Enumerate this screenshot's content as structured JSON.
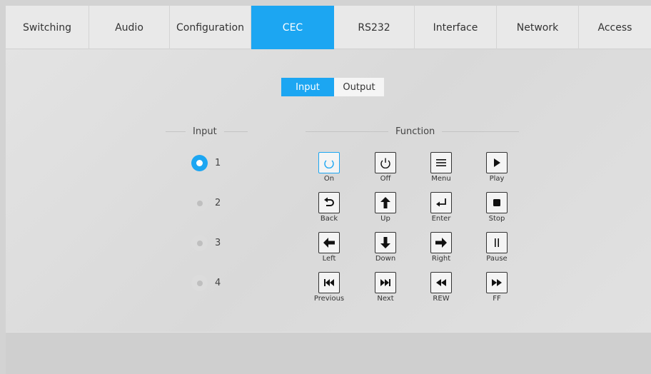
{
  "tabs": [
    {
      "label": "Switching",
      "active": false
    },
    {
      "label": "Audio",
      "active": false
    },
    {
      "label": "Configuration",
      "active": false
    },
    {
      "label": "CEC",
      "active": true
    },
    {
      "label": "RS232",
      "active": false
    },
    {
      "label": "Interface",
      "active": false
    },
    {
      "label": "Network",
      "active": false
    },
    {
      "label": "Access",
      "active": false
    }
  ],
  "subtabs": {
    "input": "Input",
    "output": "Output",
    "selected": "Input"
  },
  "input_section": {
    "heading": "Input",
    "options": [
      "1",
      "2",
      "3",
      "4"
    ],
    "selected": "1"
  },
  "function_section": {
    "heading": "Function",
    "buttons": [
      {
        "label": "On",
        "icon": "power-on-icon"
      },
      {
        "label": "Off",
        "icon": "power-off-icon"
      },
      {
        "label": "Menu",
        "icon": "menu-icon"
      },
      {
        "label": "Play",
        "icon": "play-icon"
      },
      {
        "label": "Back",
        "icon": "back-icon"
      },
      {
        "label": "Up",
        "icon": "arrow-up-icon"
      },
      {
        "label": "Enter",
        "icon": "enter-icon"
      },
      {
        "label": "Stop",
        "icon": "stop-icon"
      },
      {
        "label": "Left",
        "icon": "arrow-left-icon"
      },
      {
        "label": "Down",
        "icon": "arrow-down-icon"
      },
      {
        "label": "Right",
        "icon": "arrow-right-icon"
      },
      {
        "label": "Pause",
        "icon": "pause-icon"
      },
      {
        "label": "Previous",
        "icon": "previous-icon"
      },
      {
        "label": "Next",
        "icon": "next-icon"
      },
      {
        "label": "REW",
        "icon": "rewind-icon"
      },
      {
        "label": "FF",
        "icon": "fast-forward-icon"
      }
    ]
  },
  "colors": {
    "accent": "#1ca6f2",
    "tab_bg": "#e9e9e9",
    "panel_bg": "#dedede"
  }
}
